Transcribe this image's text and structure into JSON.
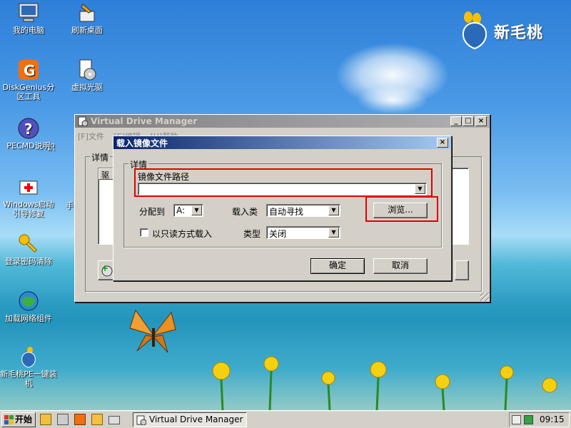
{
  "desktop": {
    "icons": [
      {
        "label": "我的电脑"
      },
      {
        "label": "刷新桌面"
      },
      {
        "label": "DiskGenius分区工具"
      },
      {
        "label": "虚拟光驱"
      },
      {
        "label": "PECMD说明"
      },
      {
        "label": "识"
      },
      {
        "label": "Windows启动引导修复"
      },
      {
        "label": "手"
      },
      {
        "label": "登录密码清除"
      },
      {
        "label": "加载网络组件"
      },
      {
        "label": "新毛桃PE一键装机"
      }
    ],
    "logo_text": "新毛桃"
  },
  "vdm_window": {
    "title": "Virtual Drive Manager",
    "menu": [
      "[F]文件",
      "[E]编辑",
      "[H]帮助"
    ],
    "group_label": "详情",
    "column_header": "驱"
  },
  "dialog": {
    "title": "载入镜像文件",
    "group_label": "详情",
    "path_label": "镜像文件路径",
    "path_value": "",
    "assign_label": "分配到",
    "assign_value": "A:",
    "load_type_label": "载入类",
    "load_type_value": "自动寻找",
    "browse_label": "浏览...",
    "readonly_label": "以只读方式载入",
    "type_label": "类型",
    "type_value": "关闭",
    "ok_label": "确定",
    "cancel_label": "取消"
  },
  "taskbar": {
    "start_label": "开始",
    "task_label": "Virtual Drive Manager",
    "clock": "09:15"
  },
  "colors": {
    "highlight_red": "#e00000",
    "title_active": "#0a246a",
    "window_face": "#d4d0c8"
  }
}
